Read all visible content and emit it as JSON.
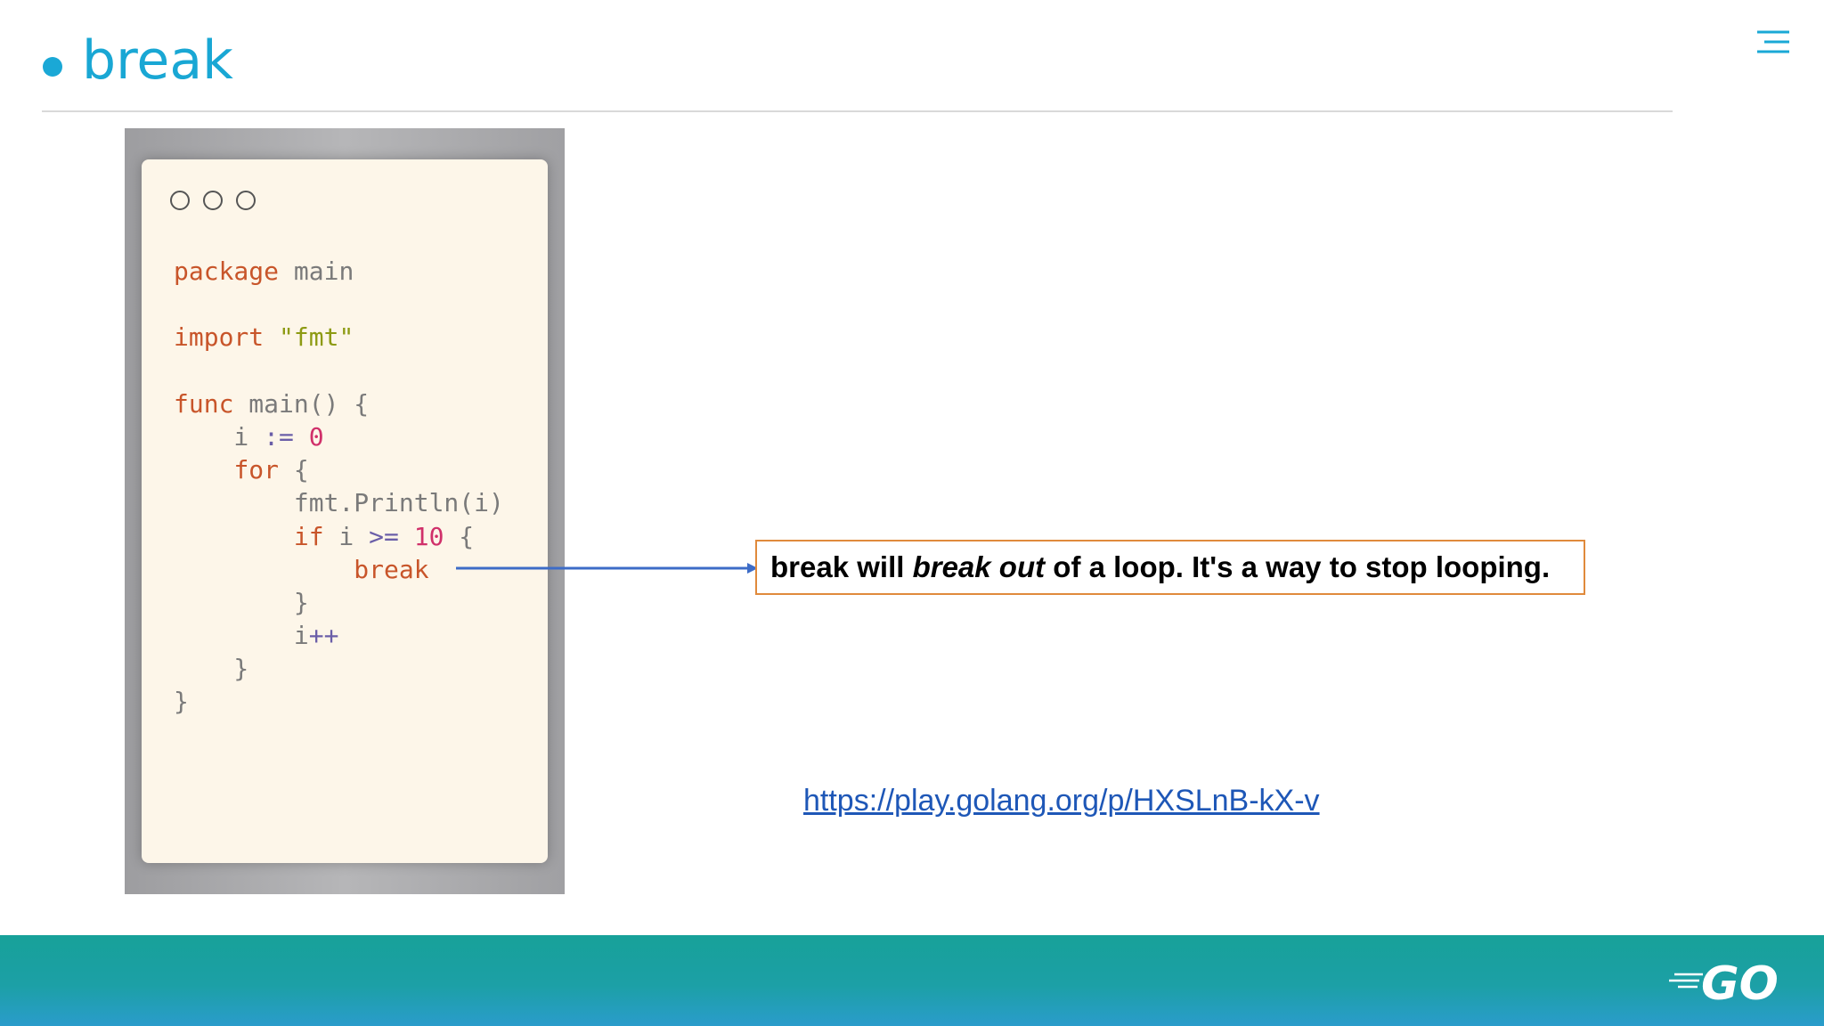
{
  "slide": {
    "title": "break"
  },
  "toolbar": {
    "menu_icon": "hamburger-menu-icon"
  },
  "code_window": {
    "lines": [
      [
        {
          "t": "package",
          "c": "kw"
        },
        {
          "t": " main"
        }
      ],
      [],
      [
        {
          "t": "import",
          "c": "kw"
        },
        {
          "t": " "
        },
        {
          "t": "\"fmt\"",
          "c": "str"
        }
      ],
      [],
      [
        {
          "t": "func",
          "c": "kw"
        },
        {
          "t": " main() {"
        }
      ],
      [
        {
          "t": "    i "
        },
        {
          "t": ":=",
          "c": "op"
        },
        {
          "t": " "
        },
        {
          "t": "0",
          "c": "num"
        }
      ],
      [
        {
          "t": "    "
        },
        {
          "t": "for",
          "c": "kw"
        },
        {
          "t": " {"
        }
      ],
      [
        {
          "t": "        fmt.Println(i)"
        }
      ],
      [
        {
          "t": "        "
        },
        {
          "t": "if",
          "c": "kw"
        },
        {
          "t": " i "
        },
        {
          "t": ">=",
          "c": "op"
        },
        {
          "t": " "
        },
        {
          "t": "10",
          "c": "num"
        },
        {
          "t": " {"
        }
      ],
      [
        {
          "t": "            "
        },
        {
          "t": "break",
          "c": "kw"
        }
      ],
      [
        {
          "t": "        }"
        }
      ],
      [
        {
          "t": "        i"
        },
        {
          "t": "++",
          "c": "op"
        }
      ],
      [
        {
          "t": "    }"
        }
      ],
      [
        {
          "t": "}"
        }
      ]
    ]
  },
  "callout": {
    "before": "break will ",
    "emphasis": "break out",
    "after": " of a loop. It's a way to stop looping."
  },
  "link": {
    "text": "https://play.golang.org/p/HXSLnB-kX-v"
  },
  "footer": {
    "logo_text": "GO"
  },
  "colors": {
    "accent": "#19a7d4",
    "keyword": "#c8552a",
    "string": "#8d9a12",
    "number": "#d0306a",
    "operator": "#6a5ea8",
    "callout_border": "#e08a3c",
    "arrow": "#3d6cc7",
    "link": "#1e57b7",
    "footer_teal": "#17a199"
  }
}
